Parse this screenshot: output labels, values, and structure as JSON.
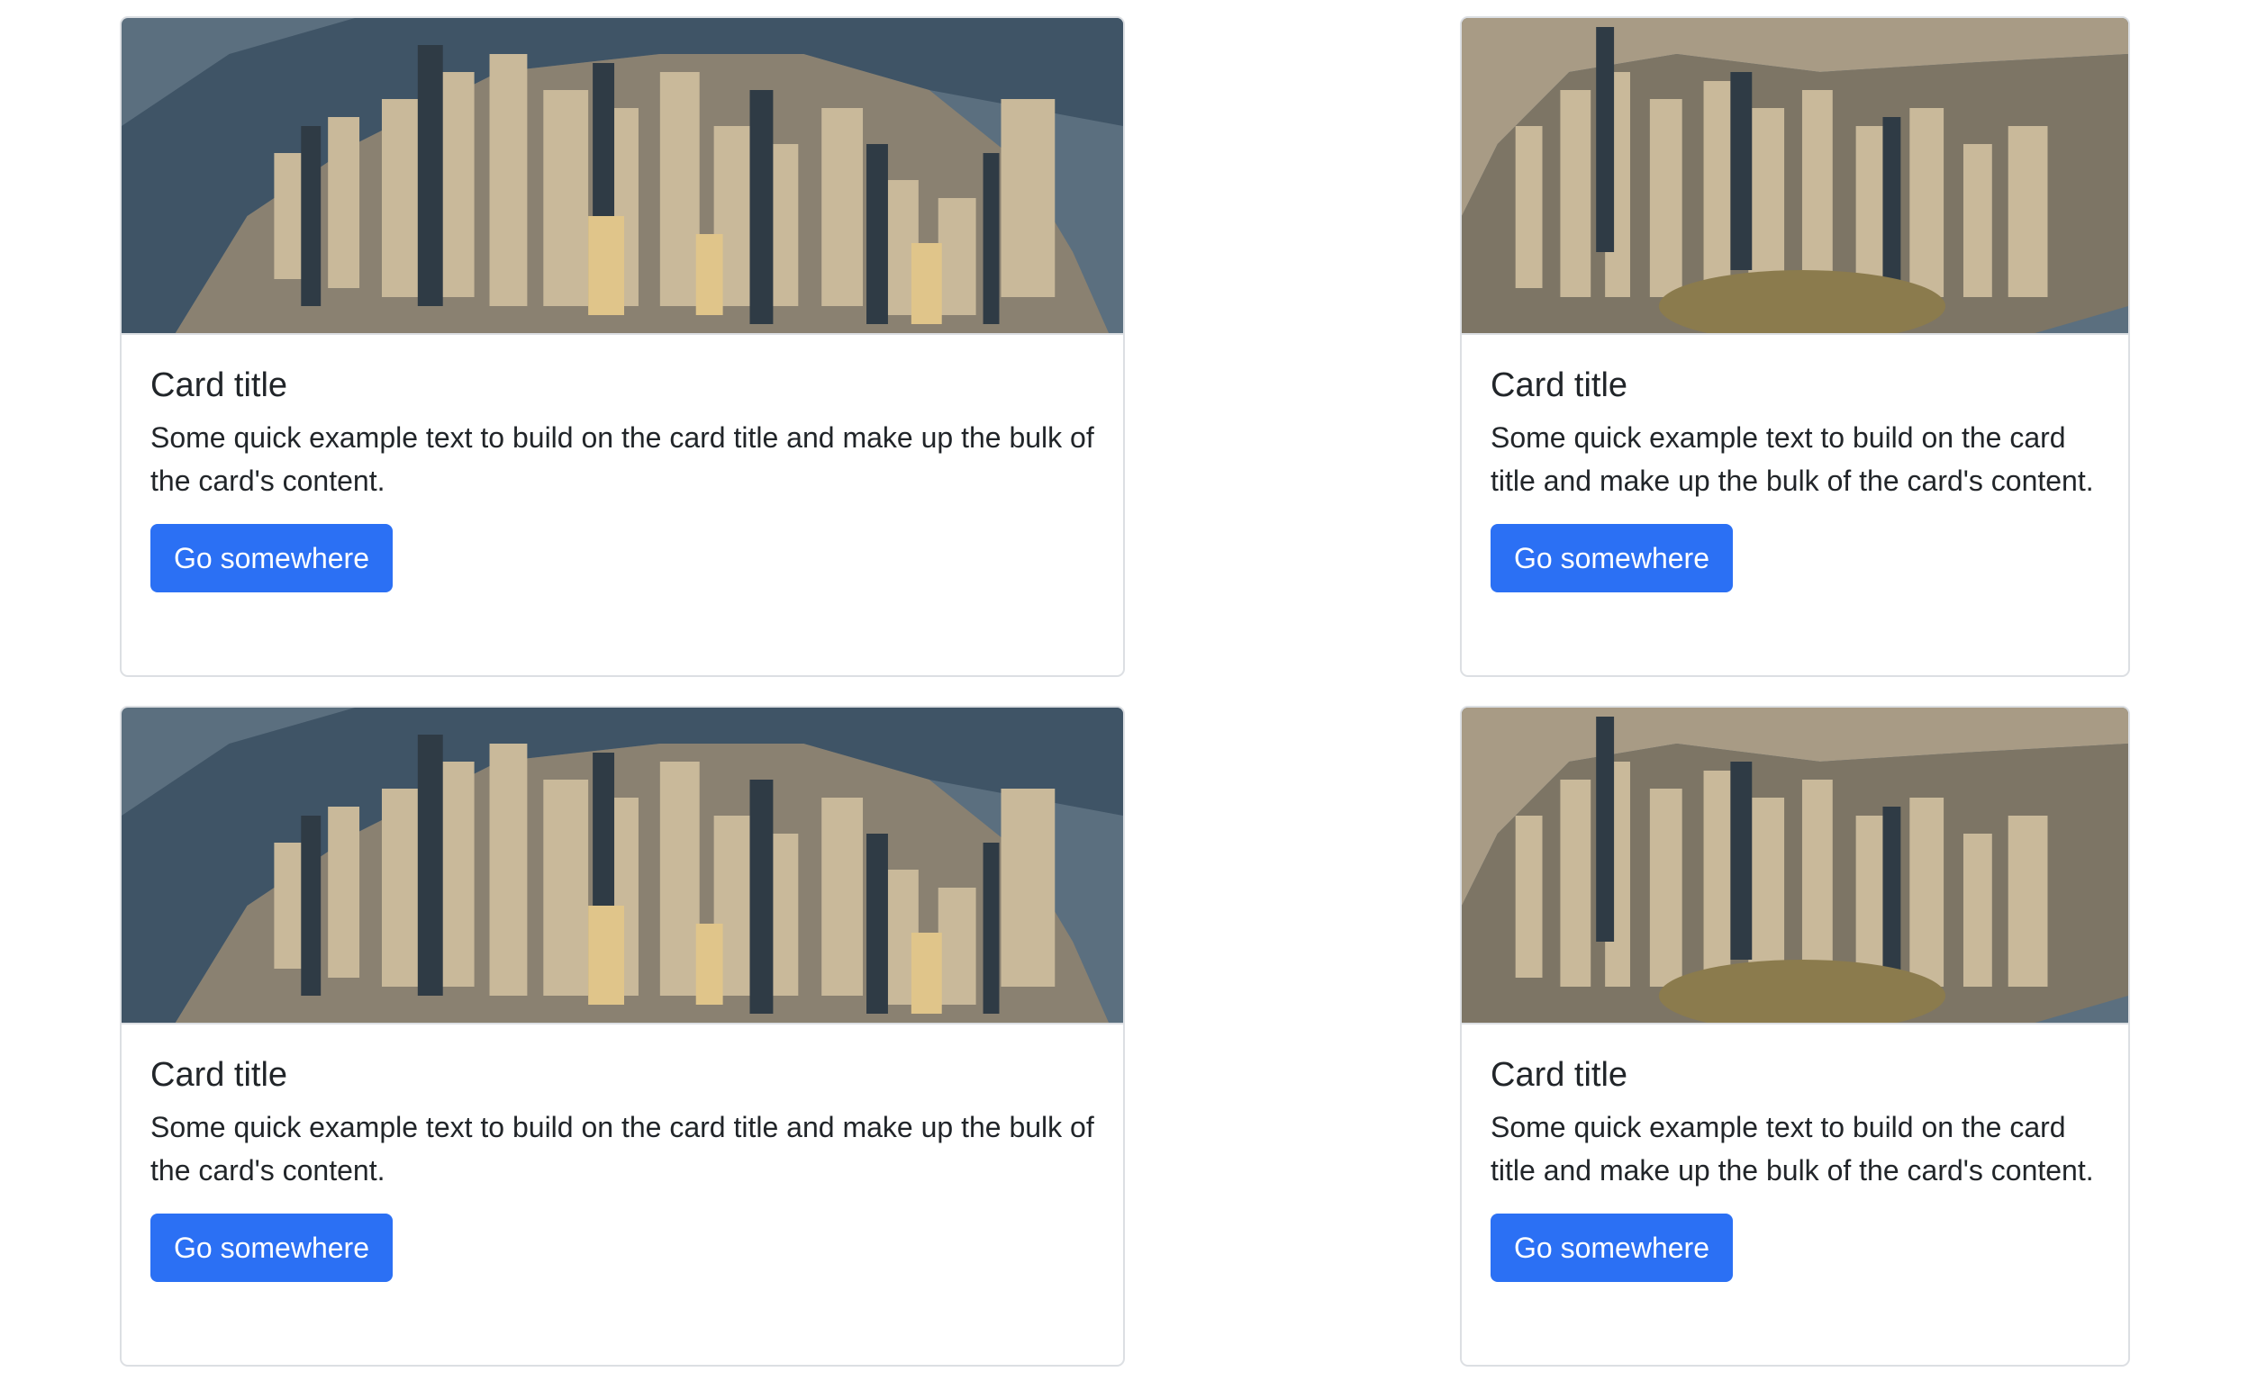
{
  "cards": [
    {
      "image_alt": "Aerial view of city skyline",
      "title": "Card title",
      "text": "Some quick example text to build on the card title and make up the bulk of the card's content.",
      "button_label": "Go somewhere"
    },
    {
      "image_alt": "Aerial view of city skyline",
      "title": "Card title",
      "text": "Some quick example text to build on the card title and make up the bulk of the card's content.",
      "button_label": "Go somewhere"
    },
    {
      "image_alt": "Aerial view of city skyline",
      "title": "Card title",
      "text": "Some quick example text to build on the card title and make up the bulk of the card's content.",
      "button_label": "Go somewhere"
    },
    {
      "image_alt": "Aerial view of city skyline",
      "title": "Card title",
      "text": "Some quick example text to build on the card title and make up the bulk of the card's content.",
      "button_label": "Go somewhere"
    }
  ],
  "colors": {
    "button": "#2b70f4",
    "water": "#4f6a80",
    "text": "#212529"
  }
}
